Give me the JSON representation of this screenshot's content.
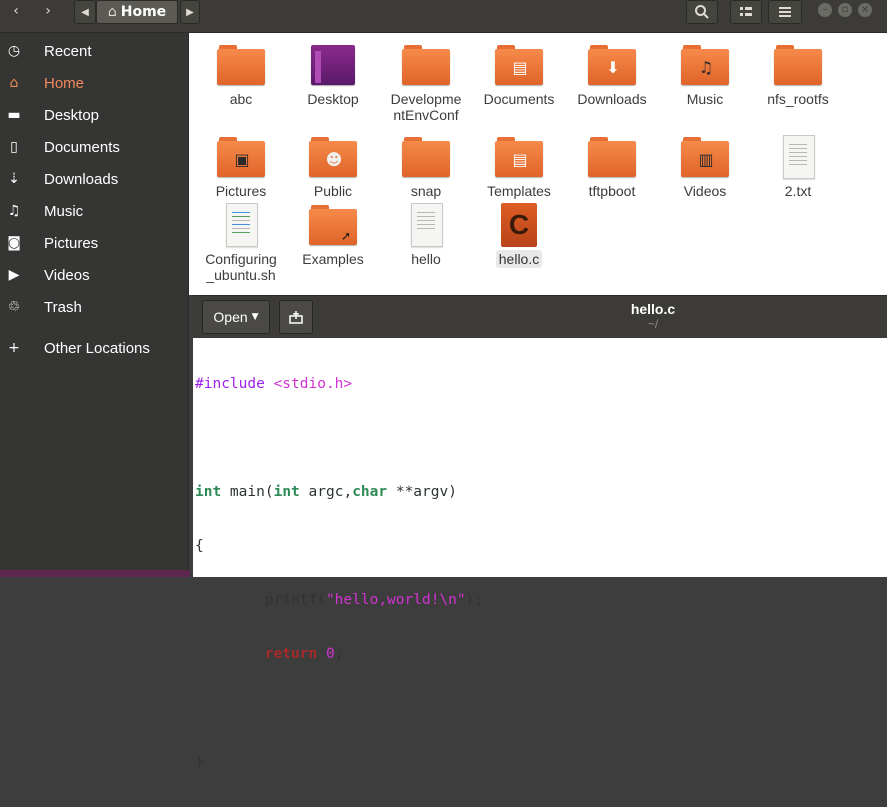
{
  "nautilus": {
    "path": {
      "home_label": "Home"
    },
    "sidebar": {
      "items": [
        {
          "label": "Recent",
          "icon": "clock-icon"
        },
        {
          "label": "Home",
          "icon": "home-icon",
          "active": true
        },
        {
          "label": "Desktop",
          "icon": "folder-icon"
        },
        {
          "label": "Documents",
          "icon": "document-icon"
        },
        {
          "label": "Downloads",
          "icon": "download-icon"
        },
        {
          "label": "Music",
          "icon": "music-icon"
        },
        {
          "label": "Pictures",
          "icon": "camera-icon"
        },
        {
          "label": "Videos",
          "icon": "video-icon"
        },
        {
          "label": "Trash",
          "icon": "trash-icon"
        },
        {
          "label": "Other Locations",
          "icon": "plus-icon"
        }
      ]
    },
    "files": [
      {
        "name": "abc",
        "type": "folder"
      },
      {
        "name": "Desktop",
        "type": "desktop-folder"
      },
      {
        "name": "Developme",
        "name2": "ntEnvConf",
        "type": "folder"
      },
      {
        "name": "Documents",
        "type": "documents-folder"
      },
      {
        "name": "Downloads",
        "type": "downloads-folder"
      },
      {
        "name": "Music",
        "type": "music-folder"
      },
      {
        "name": "nfs_rootfs",
        "type": "folder"
      },
      {
        "name": "Pictures",
        "type": "pictures-folder"
      },
      {
        "name": "Public",
        "type": "public-folder"
      },
      {
        "name": "snap",
        "type": "folder"
      },
      {
        "name": "Templates",
        "type": "templates-folder"
      },
      {
        "name": "tftpboot",
        "type": "folder"
      },
      {
        "name": "Videos",
        "type": "videos-folder"
      },
      {
        "name": "2.txt",
        "type": "text-file"
      },
      {
        "name": "Configuring",
        "name2": "_ubuntu.sh",
        "type": "script-file"
      },
      {
        "name": "Examples",
        "type": "link-folder"
      },
      {
        "name": "hello",
        "type": "text-file"
      },
      {
        "name": "hello.c",
        "type": "c-source-file",
        "selected": true
      }
    ]
  },
  "gedit": {
    "open_label": "Open",
    "title": "hello.c",
    "subtitle": "~/",
    "code": {
      "l1_pp": "#include",
      "l1_inc": "<stdio.h>",
      "l3_kw1": "int",
      "l3_a": " main(",
      "l3_kw2": "int",
      "l3_b": " argc,",
      "l3_kw3": "char",
      "l3_c": " **argv)",
      "l4": "{",
      "l5_a": "        printf(",
      "l5_str": "\"hello,world!\\n\"",
      "l5_b": ");",
      "l6_indent": "        ",
      "l6_kw": "return",
      "l6_num": "0",
      "l6_b": ";",
      "l8": "}"
    }
  }
}
